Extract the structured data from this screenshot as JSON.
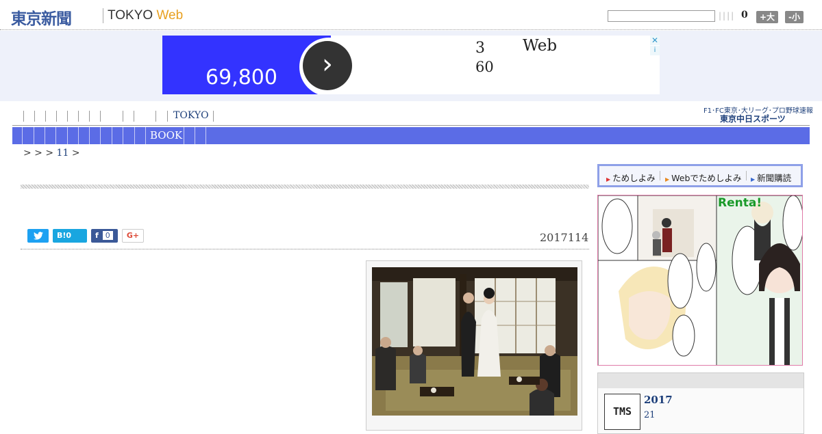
{
  "header": {
    "logo_main": "東京新聞",
    "logo_sub_prefix": "TOKYO",
    "logo_sub_suffix": "Web",
    "search": {
      "placeholder": "",
      "value": ""
    },
    "bars": "||||",
    "count": "0",
    "size_large": "+大",
    "size_small": "-小"
  },
  "ad": {
    "price": "69,800",
    "arrow": "›",
    "line1": "3",
    "line1b": "Web",
    "line2": "60",
    "close": "✕",
    "info": "i"
  },
  "nav": {
    "primary_label": "TOKYO",
    "secondary_label": "BOOK",
    "sponsor_top": "F1･FC東京･大リーグ･プロ野球速報",
    "sponsor_bottom": "東京中日スポーツ"
  },
  "breadcrumb": {
    "prefix": "> > >",
    "link": "11",
    "suffix": ">"
  },
  "article": {
    "date": "2017114",
    "share": {
      "twitter": "t",
      "hatena": "B!0",
      "facebook": "f",
      "facebook_count": "0",
      "google": "G+"
    }
  },
  "sidebar": {
    "tabs": [
      "ためしよみ",
      "Webでためしよみ",
      "新聞購読"
    ],
    "manga_badge": "Renta!",
    "tms_logo": "TMS",
    "tms_title": "2017",
    "tms_sub": "21"
  },
  "colors": {
    "brand": "#3a5ba0",
    "nav_bar": "#5b6ce6",
    "ad_blue": "#3333ff",
    "web_orange": "#e8a020"
  }
}
